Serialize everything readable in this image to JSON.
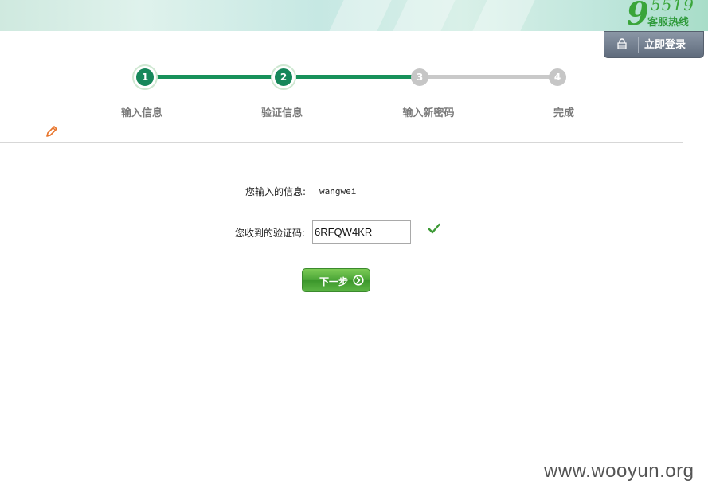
{
  "header": {
    "hotline_big_digit": "9",
    "hotline_digits": "5519",
    "hotline_label": "客服热线"
  },
  "login_button": {
    "label": "立即登录",
    "icon": "lock-icon"
  },
  "steps": [
    {
      "number": "1",
      "label": "输入信息",
      "state": "done"
    },
    {
      "number": "2",
      "label": "验证信息",
      "state": "done"
    },
    {
      "number": "3",
      "label": "输入新密码",
      "state": "todo"
    },
    {
      "number": "4",
      "label": "完成",
      "state": "todo"
    }
  ],
  "form": {
    "info_label": "您输入的信息:",
    "info_value": "wangwei",
    "code_label": "您收到的验证码:",
    "code_value": "6RFQW4KR",
    "code_status_icon": "checkmark-icon"
  },
  "next_button": {
    "label": "下一步",
    "icon": "arrow-circle-icon"
  },
  "watermark": "www.wooyun.org",
  "colors": {
    "step_done": "#16875a",
    "step_todo": "#c6c6c6",
    "button_green": "#4aa437",
    "login_gray": "#6f7a89"
  }
}
